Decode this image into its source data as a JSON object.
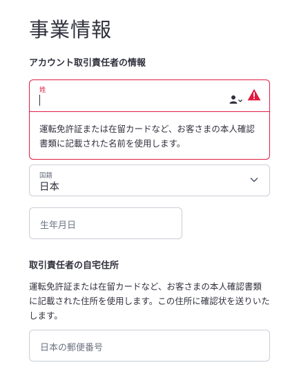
{
  "page": {
    "title": "事業情報"
  },
  "section1": {
    "heading": "アカウント取引責任者の情報",
    "last_name": {
      "label": "姓",
      "value": "",
      "error_message": "運転免許証または在留カードなど、お客さまの本人確認書類に記載された名前を使用します。"
    },
    "nationality": {
      "label": "国籍",
      "value": "日本"
    },
    "dob": {
      "placeholder": "生年月日"
    }
  },
  "section2": {
    "heading": "取引責任者の自宅住所",
    "description": "運転免許証または在留カードなど、お客さまの本人確認書類に記載された住所を使用します。この住所に確認状を送りいたします。",
    "postal": {
      "placeholder": "日本の郵便番号"
    }
  },
  "icons": {
    "autofill": "person-autofill-icon",
    "warning": "warning-triangle-icon",
    "chevron": "chevron-down-icon"
  },
  "colors": {
    "error": "#df1b41",
    "border": "#c9cdd4",
    "text": "#30313d",
    "muted": "#6b7280"
  }
}
